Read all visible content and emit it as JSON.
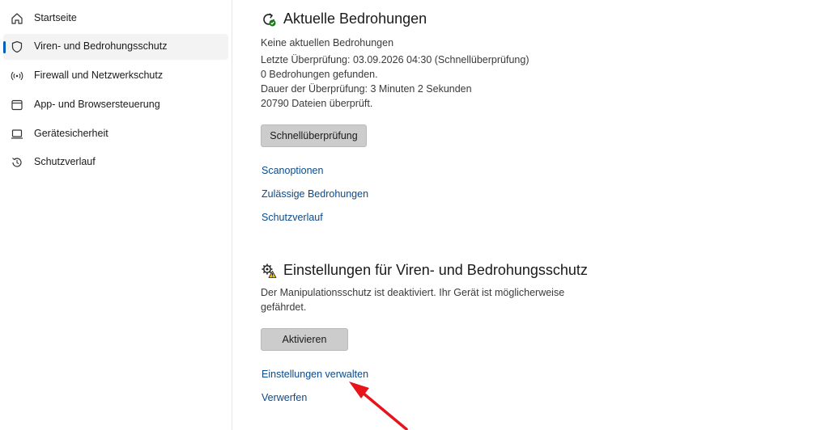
{
  "sidebar": {
    "items": [
      {
        "label": "Startseite",
        "icon": "home-icon"
      },
      {
        "label": "Viren- und Bedrohungsschutz",
        "icon": "shield-icon",
        "active": true
      },
      {
        "label": "Firewall und Netzwerkschutz",
        "icon": "wifi-antenna-icon"
      },
      {
        "label": "App- und Browsersteuerung",
        "icon": "browser-window-icon"
      },
      {
        "label": "Gerätesicherheit",
        "icon": "laptop-icon"
      },
      {
        "label": "Schutzverlauf",
        "icon": "history-icon"
      }
    ]
  },
  "threats": {
    "title": "Aktuelle Bedrohungen",
    "line1": "Keine aktuellen Bedrohungen",
    "line2": "Letzte Überprüfung: 03.09.2026 04:30 (Schnellüberprüfung)",
    "line3": "0 Bedrohungen gefunden.",
    "line4": "Dauer der Überprüfung: 3 Minuten 2 Sekunden",
    "line5": "20790 Dateien überprüft.",
    "scan_button": "Schnellüberprüfung",
    "links": {
      "scan_options": "Scanoptionen",
      "allowed_threats": "Zulässige Bedrohungen",
      "history": "Schutzverlauf"
    }
  },
  "settings": {
    "title": "Einstellungen für Viren- und Bedrohungsschutz",
    "desc_line1": "Der Manipulationsschutz ist deaktiviert. Ihr Gerät ist möglicherweise",
    "desc_line2": "gefährdet.",
    "activate_button": "Aktivieren",
    "links": {
      "manage": "Einstellungen verwalten",
      "dismiss": "Verwerfen"
    }
  },
  "colors": {
    "accent": "#005fb8",
    "link": "#0b4a8a",
    "button_bg": "#cccccc",
    "arrow": "#e8141b",
    "shield_green": "#107c10",
    "warning_yellow": "#f7c600"
  }
}
